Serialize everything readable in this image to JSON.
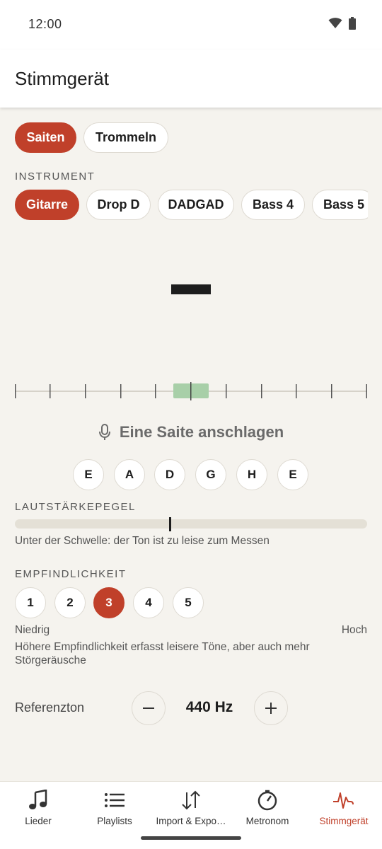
{
  "status": {
    "time": "12:00"
  },
  "app": {
    "title": "Stimmgerät"
  },
  "mode_tabs": [
    {
      "label": "Saiten",
      "active": true
    },
    {
      "label": "Trommeln",
      "active": false
    }
  ],
  "instrument": {
    "section_label": "INSTRUMENT",
    "options": [
      {
        "label": "Gitarre",
        "active": true
      },
      {
        "label": "Drop D",
        "active": false
      },
      {
        "label": "DADGAD",
        "active": false
      },
      {
        "label": "Bass 4",
        "active": false
      },
      {
        "label": "Bass 5",
        "active": false
      }
    ]
  },
  "tuner": {
    "note_display": "—",
    "hint": "Eine Saite anschlagen",
    "strings": [
      "E",
      "A",
      "D",
      "G",
      "H",
      "E"
    ]
  },
  "volume": {
    "section_label": "LAUTSTÄRKEPEGEL",
    "threshold_fraction": 0.44,
    "message": "Unter der Schwelle: der Ton ist zu leise zum Messen"
  },
  "sensitivity": {
    "section_label": "EMPFINDLICHKEIT",
    "levels": [
      "1",
      "2",
      "3",
      "4",
      "5"
    ],
    "selected": "3",
    "low_label": "Niedrig",
    "high_label": "Hoch",
    "description": "Höhere Empfindlichkeit erfasst leisere Töne, aber auch mehr Störgeräusche"
  },
  "reference": {
    "label": "Referenzton",
    "value": "440 Hz"
  },
  "nav": {
    "items": [
      {
        "label": "Lieder",
        "icon": "music-note-icon",
        "active": false
      },
      {
        "label": "Playlists",
        "icon": "list-icon",
        "active": false
      },
      {
        "label": "Import & Expo…",
        "icon": "import-export-icon",
        "active": false
      },
      {
        "label": "Metronom",
        "icon": "metronome-icon",
        "active": false
      },
      {
        "label": "Stimmgerät",
        "icon": "tuner-pulse-icon",
        "active": true
      }
    ]
  },
  "colors": {
    "accent": "#c0402a",
    "background": "#f5f3ee",
    "in_tune_zone": "#a8cfa8"
  }
}
